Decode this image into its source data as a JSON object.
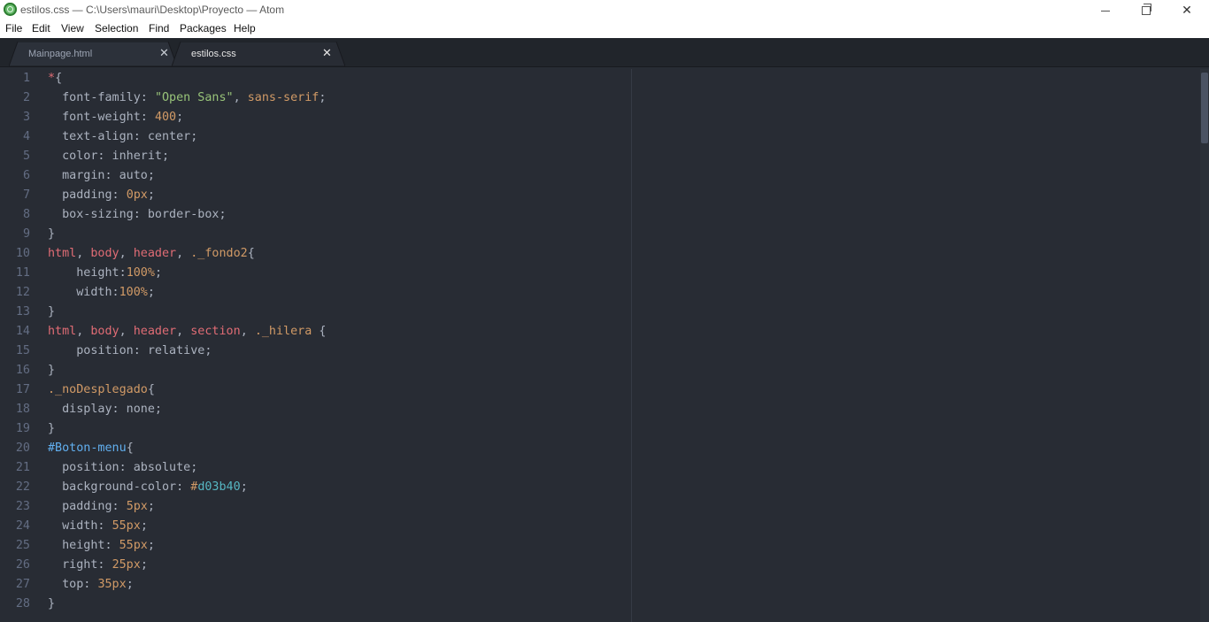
{
  "window": {
    "title": "estilos.css — C:\\Users\\mauri\\Desktop\\Proyecto — Atom",
    "icon": "atom-icon",
    "controls": {
      "minimize": "minimize-icon",
      "maximize": "restore-icon",
      "close": "✕"
    }
  },
  "menu": [
    "File",
    "Edit",
    "View",
    "Selection",
    "Find",
    "Packages",
    "Help"
  ],
  "tabs": [
    {
      "label": "Mainpage.html",
      "active": false,
      "close": "✕"
    },
    {
      "label": "estilos.css",
      "active": true,
      "close": "✕"
    }
  ],
  "colors": {
    "editor_bg": "#282c34",
    "tabbar_bg": "#21252b",
    "selector": "#e06c75",
    "string": "#98c379",
    "number": "#d19a66",
    "id": "#61afef",
    "hex": "#56b6c2",
    "text": "#abb2bf",
    "line_number": "#636d83"
  },
  "editor": {
    "line_numbers": [
      "1",
      "2",
      "3",
      "4",
      "5",
      "6",
      "7",
      "8",
      "9",
      "10",
      "11",
      "12",
      "13",
      "14",
      "15",
      "16",
      "17",
      "18",
      "19",
      "20",
      "21",
      "22",
      "23",
      "24",
      "25",
      "26",
      "27",
      "28"
    ],
    "lines": [
      [
        [
          "t-sel",
          "*"
        ],
        [
          "t-pun",
          "{"
        ]
      ],
      [
        [
          "t-prop",
          "  font-family: "
        ],
        [
          "t-str",
          "\"Open Sans\""
        ],
        [
          "t-pun",
          ", "
        ],
        [
          "t-num",
          "sans-serif"
        ],
        [
          "t-pun",
          ";"
        ]
      ],
      [
        [
          "t-prop",
          "  font-weight: "
        ],
        [
          "t-num",
          "400"
        ],
        [
          "t-pun",
          ";"
        ]
      ],
      [
        [
          "t-prop",
          "  text-align: center;"
        ]
      ],
      [
        [
          "t-prop",
          "  color: inherit;"
        ]
      ],
      [
        [
          "t-prop",
          "  margin: auto;"
        ]
      ],
      [
        [
          "t-prop",
          "  padding: "
        ],
        [
          "t-num",
          "0px"
        ],
        [
          "t-pun",
          ";"
        ]
      ],
      [
        [
          "t-prop",
          "  box-sizing: border-box;"
        ]
      ],
      [
        [
          "t-pun",
          "}"
        ]
      ],
      [
        [
          "t-sel",
          "html"
        ],
        [
          "t-pun",
          ", "
        ],
        [
          "t-sel",
          "body"
        ],
        [
          "t-pun",
          ", "
        ],
        [
          "t-sel",
          "header"
        ],
        [
          "t-pun",
          ", "
        ],
        [
          "t-cls",
          "._fondo2"
        ],
        [
          "t-pun",
          "{"
        ]
      ],
      [
        [
          "t-prop",
          "    height:"
        ],
        [
          "t-num",
          "100%"
        ],
        [
          "t-pun",
          ";"
        ]
      ],
      [
        [
          "t-prop",
          "    width:"
        ],
        [
          "t-num",
          "100%"
        ],
        [
          "t-pun",
          ";"
        ]
      ],
      [
        [
          "t-pun",
          "}"
        ]
      ],
      [
        [
          "t-sel",
          "html"
        ],
        [
          "t-pun",
          ", "
        ],
        [
          "t-sel",
          "body"
        ],
        [
          "t-pun",
          ", "
        ],
        [
          "t-sel",
          "header"
        ],
        [
          "t-pun",
          ", "
        ],
        [
          "t-sel",
          "section"
        ],
        [
          "t-pun",
          ", "
        ],
        [
          "t-cls",
          "._hilera"
        ],
        [
          "t-pun",
          " {"
        ]
      ],
      [
        [
          "t-prop",
          "    position: relative;"
        ]
      ],
      [
        [
          "t-pun",
          "}"
        ]
      ],
      [
        [
          "t-cls",
          "._noDesplegado"
        ],
        [
          "t-pun",
          "{"
        ]
      ],
      [
        [
          "t-prop",
          "  display: none;"
        ]
      ],
      [
        [
          "t-pun",
          "}"
        ]
      ],
      [
        [
          "t-id",
          "#Boton-menu"
        ],
        [
          "t-pun",
          "{"
        ]
      ],
      [
        [
          "t-prop",
          "  position: absolute;"
        ]
      ],
      [
        [
          "t-prop",
          "  background-color: "
        ],
        [
          "t-num",
          "#"
        ],
        [
          "t-hex",
          "d03b40"
        ],
        [
          "t-pun",
          ";"
        ]
      ],
      [
        [
          "t-prop",
          "  padding: "
        ],
        [
          "t-num",
          "5px"
        ],
        [
          "t-pun",
          ";"
        ]
      ],
      [
        [
          "t-prop",
          "  width: "
        ],
        [
          "t-num",
          "55px"
        ],
        [
          "t-pun",
          ";"
        ]
      ],
      [
        [
          "t-prop",
          "  height: "
        ],
        [
          "t-num",
          "55px"
        ],
        [
          "t-pun",
          ";"
        ]
      ],
      [
        [
          "t-prop",
          "  right: "
        ],
        [
          "t-num",
          "25px"
        ],
        [
          "t-pun",
          ";"
        ]
      ],
      [
        [
          "t-prop",
          "  top: "
        ],
        [
          "t-num",
          "35px"
        ],
        [
          "t-pun",
          ";"
        ]
      ],
      [
        [
          "t-pun",
          "}"
        ]
      ]
    ]
  }
}
